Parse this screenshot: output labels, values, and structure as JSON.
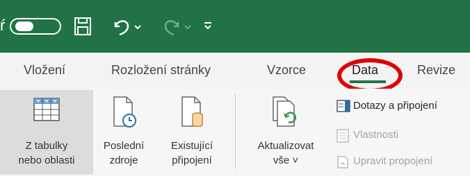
{
  "colors": {
    "brand": "#217346",
    "highlight": "#e00000"
  },
  "quick_access": {
    "autosave_toggle": {
      "state": "on"
    },
    "icons": [
      "save-icon",
      "undo-icon",
      "undo-dropdown-icon",
      "redo-icon",
      "redo-dropdown-icon",
      "customize-icon"
    ]
  },
  "tabs": [
    {
      "label": "Vložení"
    },
    {
      "label": "Rozložení stránky"
    },
    {
      "label": "Vzorce"
    },
    {
      "label": "Data",
      "active": true
    },
    {
      "label": "Revize"
    }
  ],
  "ribbon": {
    "buttons": [
      {
        "line1": "Z tabulky",
        "line2": "nebo oblasti",
        "icon": "table-icon"
      },
      {
        "line1": "Poslední",
        "line2": "zdroje",
        "icon": "recent-sources-icon"
      },
      {
        "line1": "Existující",
        "line2": "připojení",
        "icon": "existing-connections-icon"
      },
      {
        "line1": "Aktualizovat",
        "line2": "vše ˅",
        "icon": "refresh-all-icon"
      }
    ],
    "small_items": [
      {
        "label": "Dotazy a připojení",
        "icon": "queries-icon",
        "enabled": true
      },
      {
        "label": "Vlastnosti",
        "icon": "properties-icon",
        "enabled": false
      },
      {
        "label": "Upravit propojení",
        "icon": "edit-links-icon",
        "enabled": false
      }
    ]
  }
}
